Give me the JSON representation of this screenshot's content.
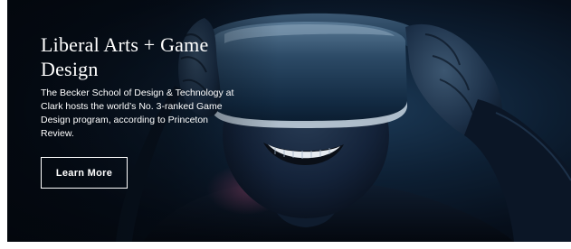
{
  "hero": {
    "title": "Liberal Arts + Game Design",
    "description": "The Becker School of Design & Technology at Clark hosts the world’s No. 3-ranked Game Design program, according to Princeton Review.",
    "button_label": "Learn More",
    "image_subject": "person-wearing-vr-headset",
    "colors": {
      "background": "#060e1a",
      "text": "#ffffff",
      "button_border": "#ffffff"
    }
  }
}
